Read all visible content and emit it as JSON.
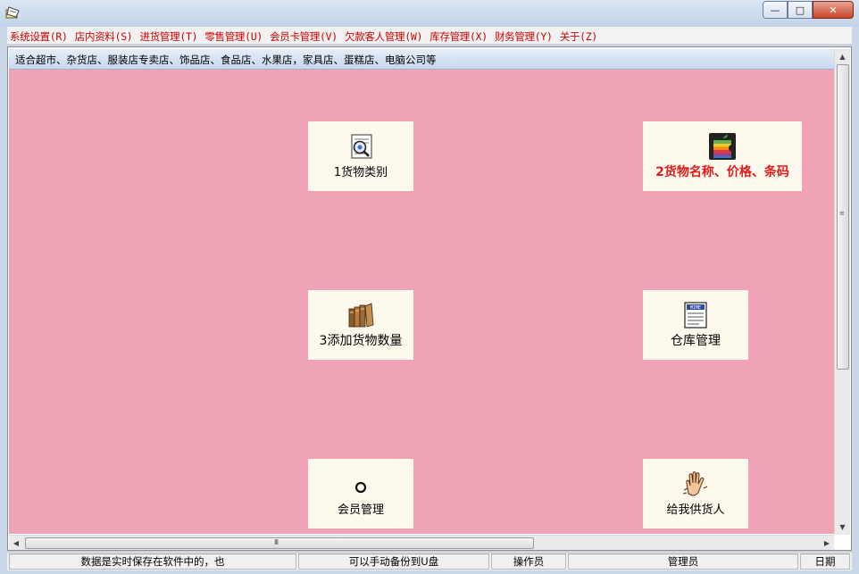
{
  "window": {
    "minimize": "—",
    "maximize": "□",
    "close": "✕"
  },
  "menu": [
    "系统设置(R)",
    "店内资料(S)",
    "进货管理(T)",
    "零售管理(U)",
    "会员卡管理(V)",
    "欠款客人管理(W)",
    "库存管理(X)",
    "财务管理(Y)",
    "关于(Z)"
  ],
  "info": "适合超市、杂货店、服装店专卖店、饰品店、食品店、水果店，家具店、蛋糕店、电脑公司等",
  "tiles": [
    {
      "label": "1货物类别",
      "icon": "magnifier-document-icon"
    },
    {
      "label": "2货物名称、价格、条码",
      "icon": "apple-logo-icon",
      "highlight": true
    },
    {
      "label": "3添加货物数量",
      "icon": "books-icon"
    },
    {
      "label": "仓库管理",
      "icon": "mime-document-icon"
    },
    {
      "label": "会员管理",
      "icon": "ring-icon"
    },
    {
      "label": "给我供货人",
      "icon": "hand-icon"
    }
  ],
  "status": {
    "p1": "数据是实时保存在软件中的，也",
    "p2": "可以手动备份到U盘",
    "p3": "操作员",
    "p4": "管理员",
    "p5": "日期"
  },
  "colors": {
    "canvas": "#f0a3b4",
    "menu_text": "#cc0000",
    "tile_bg": "#fdf9ec",
    "highlight_label": "#e11b1b"
  },
  "scrollbar_grip": "III",
  "arrows": {
    "up": "▲",
    "down": "▼",
    "left": "◀",
    "right": "▶"
  }
}
